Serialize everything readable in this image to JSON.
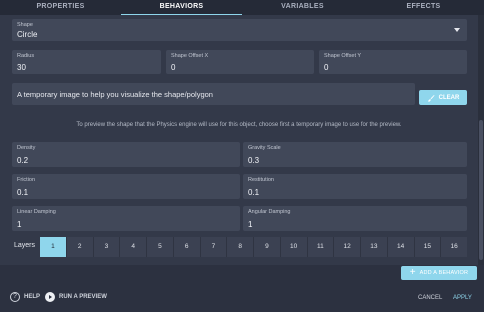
{
  "tabs": [
    {
      "label": "PROPERTIES",
      "active": false
    },
    {
      "label": "BEHAVIORS",
      "active": true
    },
    {
      "label": "VARIABLES",
      "active": false
    },
    {
      "label": "EFFECTS",
      "active": false
    }
  ],
  "shape": {
    "label": "Shape",
    "value": "Circle"
  },
  "radius": {
    "label": "Radius",
    "value": "30"
  },
  "shape_offset_x": {
    "label": "Shape Offset X",
    "value": "0"
  },
  "shape_offset_y": {
    "label": "Shape Offset Y",
    "value": "0"
  },
  "temp_image": {
    "text": "A temporary image to help you visualize the shape/polygon",
    "clear_label": "CLEAR"
  },
  "hint": "To preview the shape that the Physics engine will use for this object, choose first a temporary image to use for the preview.",
  "density": {
    "label": "Density",
    "value": "0.2"
  },
  "gravity_scale": {
    "label": "Gravity Scale",
    "value": "0.3"
  },
  "friction": {
    "label": "Friction",
    "value": "0.1"
  },
  "restitution": {
    "label": "Restitution",
    "value": "0.1"
  },
  "linear_damping": {
    "label": "Linear Damping",
    "value": "1"
  },
  "angular_damping": {
    "label": "Angular Damping",
    "value": "1"
  },
  "layers": {
    "label": "Layers",
    "items": [
      "1",
      "2",
      "3",
      "4",
      "5",
      "6",
      "7",
      "8",
      "9",
      "10",
      "11",
      "12",
      "13",
      "14",
      "15",
      "16"
    ],
    "selected": "1"
  },
  "add_behavior_label": "ADD A BEHAVIOR",
  "footer": {
    "help": "HELP",
    "run_preview": "RUN A PREVIEW",
    "cancel": "CANCEL",
    "apply": "APPLY"
  },
  "colors": {
    "accent": "#8fd6ec",
    "background": "#2c3140",
    "field": "#414859"
  }
}
